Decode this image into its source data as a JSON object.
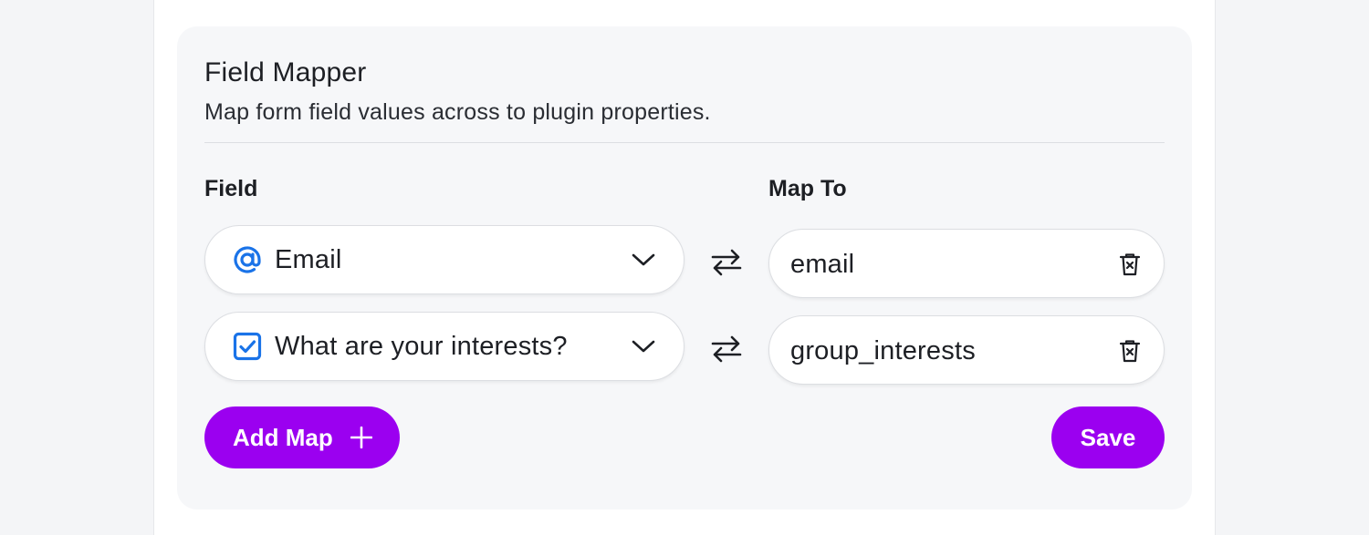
{
  "panel": {
    "title": "Field Mapper",
    "subtitle": "Map form field values across to plugin properties."
  },
  "columns": {
    "field_label": "Field",
    "map_to_label": "Map To"
  },
  "rows": [
    {
      "field_value": "Email",
      "field_icon": "at-sign-icon",
      "map_to_value": "email"
    },
    {
      "field_value": "What are your interests?",
      "field_icon": "checkbox-checked-icon",
      "map_to_value": "group_interests"
    }
  ],
  "actions": {
    "add_map_label": "Add Map",
    "save_label": "Save"
  },
  "colors": {
    "accent": "#9b00f0",
    "icon_blue": "#1a73e8"
  }
}
